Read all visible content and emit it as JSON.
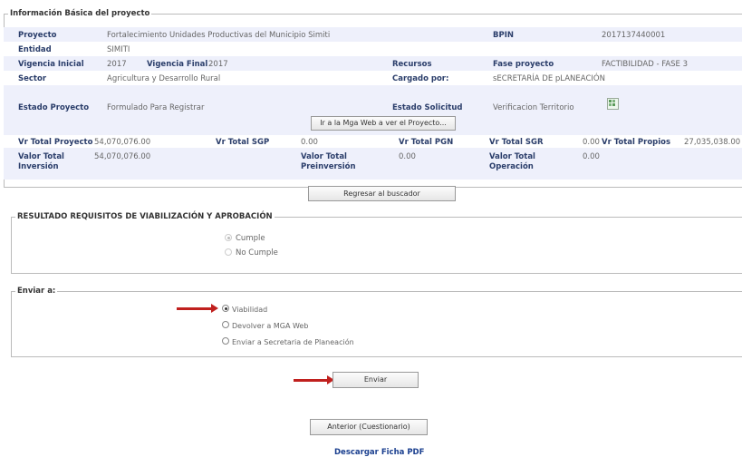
{
  "info": {
    "legend": "Información Básica del proyecto",
    "proyecto_label": "Proyecto",
    "proyecto_value": "Fortalecimiento Unidades Productivas del Municipio Simiti",
    "bpin_label": "BPIN",
    "bpin_value": "2017137440001",
    "entidad_label": "Entidad",
    "entidad_value": "SIMITI",
    "vig_ini_label": "Vigencia Inicial",
    "vig_ini_value": "2017",
    "vig_fin_label": "Vigencia Final",
    "vig_fin_value": "2017",
    "recursos_label": "Recursos",
    "fase_label": "Fase proyecto",
    "fase_value": "FACTIBILIDAD - FASE 3",
    "sector_label": "Sector",
    "sector_value": "Agricultura y Desarrollo Rural",
    "cargado_label": "Cargado por:",
    "cargado_value": "sECRETARÍA DE pLANEACIÓN",
    "estado_proy_label": "Estado Proyecto",
    "estado_proy_value": "Formulado Para Registrar",
    "estado_sol_label": "Estado Solicitud",
    "estado_sol_value": "Verificacion Territorio",
    "mga_button": "Ir a la Mga Web a ver el Proyecto...",
    "vt_proyecto_label": "Vr Total Proyecto",
    "vt_proyecto_value": "54,070,076.00",
    "vt_sgp_label": "Vr Total SGP",
    "vt_sgp_value": "0.00",
    "vt_pgn_label": "Vr Total PGN",
    "vt_sgr_label": "Vr Total SGR",
    "vt_sgr_value": "0.00",
    "vt_propios_label": "Vr Total Propios",
    "vt_propios_value": "27,035,038.00",
    "valor_inversion_label_1": "Valor Total",
    "valor_inversion_label_2": "Inversión",
    "valor_inversion_value": "54,070,076.00",
    "valor_preinv_label_1": "Valor Total",
    "valor_preinv_label_2": "Preinversión",
    "valor_preinv_value": "0.00",
    "valor_oper_label_1": "Valor Total",
    "valor_oper_label_2": "Operación",
    "valor_oper_value": "0.00"
  },
  "regresar_button": "Regresar al buscador",
  "resultado": {
    "legend": "RESULTADO REQUISITOS DE VIABILIZACIÓN Y APROBACIÓN",
    "cumple": "Cumple",
    "no_cumple": "No Cumple"
  },
  "enviar": {
    "legend": "Enviar a:",
    "viabilidad": "Viabilidad",
    "devolver": "Devolver a MGA Web",
    "secretaria": "Enviar a Secretaria de Planeación",
    "button": "Enviar"
  },
  "anterior_button": "Anterior (Cuestionario)",
  "descargar_link": "Descargar Ficha PDF"
}
